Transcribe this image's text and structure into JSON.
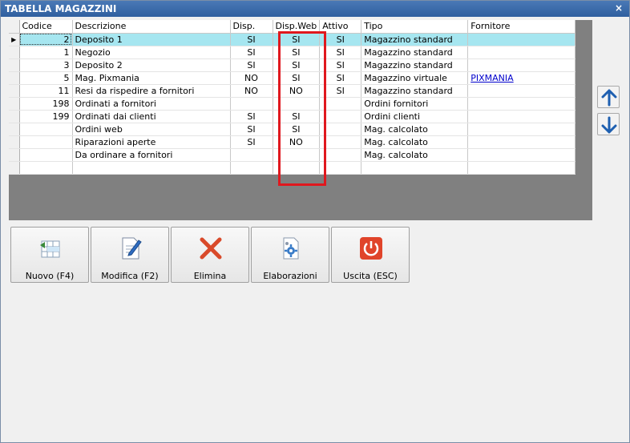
{
  "window": {
    "title": "TABELLA MAGAZZINI",
    "close_label": "×"
  },
  "grid": {
    "columns": [
      "Codice",
      "Descrizione",
      "Disp.",
      "Disp.Web",
      "Attivo",
      "Tipo",
      "Fornitore"
    ],
    "rows": [
      {
        "indicator": "▶",
        "codice": "2",
        "descrizione": "Deposito 1",
        "disp": "SI",
        "dispweb": "SI",
        "attivo": "SI",
        "tipo": "Magazzino standard",
        "fornitore": ""
      },
      {
        "indicator": "",
        "codice": "1",
        "descrizione": "Negozio",
        "disp": "SI",
        "dispweb": "SI",
        "attivo": "SI",
        "tipo": "Magazzino standard",
        "fornitore": ""
      },
      {
        "indicator": "",
        "codice": "3",
        "descrizione": "Deposito 2",
        "disp": "SI",
        "dispweb": "SI",
        "attivo": "SI",
        "tipo": "Magazzino standard",
        "fornitore": ""
      },
      {
        "indicator": "",
        "codice": "5",
        "descrizione": "Mag. Pixmania",
        "disp": "NO",
        "dispweb": "SI",
        "attivo": "SI",
        "tipo": "Magazzino virtuale",
        "fornitore": "PIXMANIA"
      },
      {
        "indicator": "",
        "codice": "11",
        "descrizione": "Resi da rispedire a fornitori",
        "disp": "NO",
        "dispweb": "NO",
        "attivo": "SI",
        "tipo": "Magazzino standard",
        "fornitore": ""
      },
      {
        "indicator": "",
        "codice": "198",
        "descrizione": "Ordinati a fornitori",
        "disp": "",
        "dispweb": "",
        "attivo": "",
        "tipo": "Ordini fornitori",
        "fornitore": ""
      },
      {
        "indicator": "",
        "codice": "199",
        "descrizione": "Ordinati dai clienti",
        "disp": "SI",
        "dispweb": "SI",
        "attivo": "",
        "tipo": "Ordini clienti",
        "fornitore": ""
      },
      {
        "indicator": "",
        "codice": "",
        "descrizione": "Ordini web",
        "disp": "SI",
        "dispweb": "SI",
        "attivo": "",
        "tipo": "Mag. calcolato",
        "fornitore": ""
      },
      {
        "indicator": "",
        "codice": "",
        "descrizione": "Riparazioni aperte",
        "disp": "SI",
        "dispweb": "NO",
        "attivo": "",
        "tipo": "Mag. calcolato",
        "fornitore": ""
      },
      {
        "indicator": "",
        "codice": "",
        "descrizione": "Da ordinare a fornitori",
        "disp": "",
        "dispweb": "",
        "attivo": "",
        "tipo": "Mag. calcolato",
        "fornitore": ""
      },
      {
        "indicator": "",
        "codice": "",
        "descrizione": "",
        "disp": "",
        "dispweb": "",
        "attivo": "",
        "tipo": "",
        "fornitore": ""
      }
    ]
  },
  "side_buttons": {
    "up_icon": "arrow-up-icon",
    "down_icon": "arrow-down-icon"
  },
  "toolbar": {
    "nuovo": "Nuovo (F4)",
    "modifica": "Modifica (F2)",
    "elimina": "Elimina",
    "elaborazioni": "Elaborazioni",
    "uscita": "Uscita (ESC)"
  },
  "colors": {
    "title_bar": "#3a6aa8",
    "selected_row": "#a6e6f0",
    "highlight_box": "#e0181e",
    "link": "#0000cc"
  }
}
